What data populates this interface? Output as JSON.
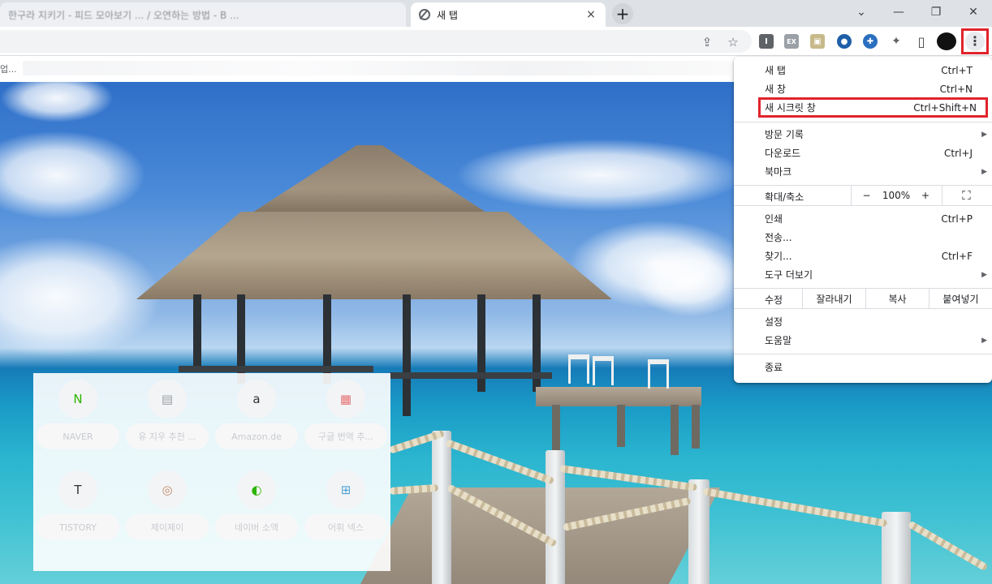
{
  "window": {
    "tabs": [
      {
        "title": "한구라 지키기 - 피드 모아보기 ... / 오연하는 방법 - B ...",
        "active": false
      },
      {
        "title": "새 탭",
        "active": true
      }
    ],
    "tab_close": "×",
    "new_tab": "+",
    "controls": {
      "minimize": "⌄",
      "restore": "—",
      "maximize": "❐",
      "close": "✕"
    }
  },
  "toolbar": {
    "share_icon": "⇪",
    "star_icon": "☆",
    "extensions": [
      "I",
      "EX",
      "▣",
      "●",
      "✚",
      "✦",
      "▯"
    ],
    "menu_dots": "⋮"
  },
  "bookmarks": {
    "text": "업..."
  },
  "shortcuts": [
    {
      "label": "NAVER",
      "icon": "N"
    },
    {
      "label": "유 지우 추천 ...",
      "icon": "▤"
    },
    {
      "label": "Amazon.de",
      "icon": "a"
    },
    {
      "label": "구글 번역 추...",
      "icon": "▦"
    },
    {
      "label": "TISTORY",
      "icon": "T"
    },
    {
      "label": "제이제이",
      "icon": "◎"
    },
    {
      "label": "네이버 소액",
      "icon": "◐"
    },
    {
      "label": "어휘 넥스",
      "icon": "⊞"
    }
  ],
  "menu": {
    "items_group1": [
      {
        "label": "새 탭",
        "shortcut": "Ctrl+T"
      },
      {
        "label": "새 창",
        "shortcut": "Ctrl+N"
      },
      {
        "label": "새 시크릿 창",
        "shortcut": "Ctrl+Shift+N"
      }
    ],
    "items_group2": [
      {
        "label": "방문 기록",
        "shortcut": "",
        "arrow": "▶"
      },
      {
        "label": "다운로드",
        "shortcut": "Ctrl+J",
        "arrow": ""
      },
      {
        "label": "북마크",
        "shortcut": "",
        "arrow": "▶"
      }
    ],
    "zoom": {
      "label": "확대/축소",
      "minus": "−",
      "value": "100%",
      "plus": "+",
      "fullscreen": "⛶"
    },
    "items_group3": [
      {
        "label": "인쇄",
        "shortcut": "Ctrl+P",
        "arrow": ""
      },
      {
        "label": "전송...",
        "shortcut": "",
        "arrow": ""
      },
      {
        "label": "찾기...",
        "shortcut": "Ctrl+F",
        "arrow": ""
      },
      {
        "label": "도구 더보기",
        "shortcut": "",
        "arrow": "▶"
      }
    ],
    "edit": {
      "label": "수정",
      "cut": "잘라내기",
      "copy": "복사",
      "paste": "붙여넣기"
    },
    "items_group4": [
      {
        "label": "설정",
        "shortcut": "",
        "arrow": ""
      },
      {
        "label": "도움말",
        "shortcut": "",
        "arrow": "▶"
      }
    ],
    "exit": {
      "label": "종료"
    }
  },
  "colors": {
    "highlight": "#e0242c",
    "tabstrip": "#dee1e6"
  }
}
